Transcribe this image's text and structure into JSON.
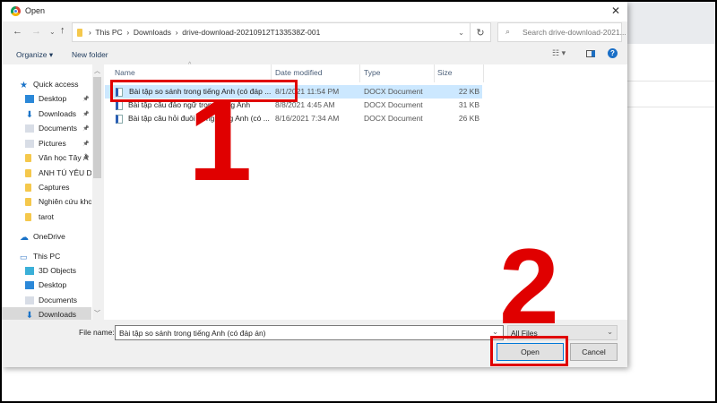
{
  "window": {
    "title": "Open"
  },
  "address": {
    "crumbs": [
      "This PC",
      "Downloads",
      "drive-download-20210912T133538Z-001"
    ],
    "search_placeholder": "Search drive-download-2021..."
  },
  "toolbar": {
    "organize": "Organize ▾",
    "new_folder": "New folder"
  },
  "nav": [
    {
      "label": "Quick access",
      "icon": "star-icon"
    },
    {
      "label": "Desktop",
      "icon": "desktop-icon",
      "pinned": true
    },
    {
      "label": "Downloads",
      "icon": "download-icon",
      "pinned": true
    },
    {
      "label": "Documents",
      "icon": "documents-icon",
      "pinned": true
    },
    {
      "label": "Pictures",
      "icon": "pictures-icon",
      "pinned": true
    },
    {
      "label": "Văn học Tây Â",
      "icon": "folder-icon",
      "pinned": true
    },
    {
      "label": "ANH TÚ YÊU DẤ",
      "icon": "folder-icon"
    },
    {
      "label": "Captures",
      "icon": "folder-icon"
    },
    {
      "label": "Nghiên cứu khoa",
      "icon": "folder-icon"
    },
    {
      "label": "tarot",
      "icon": "folder-icon"
    },
    {
      "label": "OneDrive",
      "icon": "cloud-icon"
    },
    {
      "label": "This PC",
      "icon": "computer-icon"
    },
    {
      "label": "3D Objects",
      "icon": "cube-icon"
    },
    {
      "label": "Desktop",
      "icon": "desktop-icon"
    },
    {
      "label": "Documents",
      "icon": "documents-icon"
    },
    {
      "label": "Downloads",
      "icon": "download-icon"
    }
  ],
  "columns": [
    "Name",
    "Date modified",
    "Type",
    "Size"
  ],
  "files": [
    {
      "name": "Bài tập so sánh trong tiếng Anh (có đáp ...",
      "date": "8/1/2021 11:54 PM",
      "type": "DOCX Document",
      "size": "22 KB"
    },
    {
      "name": "Bài tập câu đảo ngữ trong tiếng Anh",
      "date": "8/8/2021 4:45 AM",
      "type": "DOCX Document",
      "size": "31 KB"
    },
    {
      "name": "Bài tập câu hỏi đuôi trong tiếng Anh (có ...",
      "date": "8/16/2021 7:34 AM",
      "type": "DOCX Document",
      "size": "26 KB"
    }
  ],
  "bottom": {
    "file_name_label": "File name:",
    "file_name_value": "Bài tập so sánh trong tiếng Anh (có đáp án)",
    "filter": "All Files",
    "open": "Open",
    "cancel": "Cancel"
  },
  "annotations": {
    "step1": "1",
    "step2": "2",
    "color": "#e00000"
  }
}
